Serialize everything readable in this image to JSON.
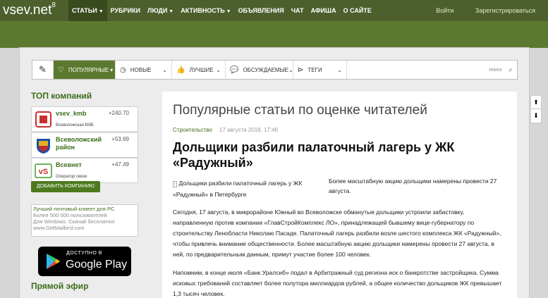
{
  "header": {
    "logo": "vsev.net",
    "logo_sup": "8",
    "nav": [
      {
        "label": "СТАТЬИ",
        "caret": true
      },
      {
        "label": "РУБРИКИ",
        "caret": false
      },
      {
        "label": "ЛЮДИ",
        "caret": true
      },
      {
        "label": "АКТИВНОСТЬ",
        "caret": true
      },
      {
        "label": "ОБЪЯВЛЕНИЯ",
        "caret": false
      },
      {
        "label": "ЧАТ",
        "caret": false
      },
      {
        "label": "АФИША",
        "caret": false
      },
      {
        "label": "О САЙТЕ",
        "caret": false
      }
    ],
    "login": "Войти",
    "register": "Зарегистрироваться"
  },
  "tabs": {
    "popular": "ПОПУЛЯРНЫЕ",
    "new": "НОВЫЕ",
    "best": "ЛУЧШИЕ",
    "discussed": "ОБСУЖДАЕМЫЕ",
    "tags": "ТЕГИ",
    "search": "поиск"
  },
  "sidebar": {
    "title": "ТОП компаний",
    "companies": [
      {
        "name": "vsev_kmb",
        "sub": "Всеволожская КМБ",
        "score": "+240.70"
      },
      {
        "name": "Всеволожский район",
        "sub": "",
        "score": "+53.69"
      },
      {
        "name": "Всевнет",
        "sub": "Оператор связи",
        "score": "+47.49"
      }
    ],
    "add_button": "ДОБАВИТЬ КОМПАНИЮ",
    "ad": {
      "line1": "Лучший почтовый клиент для PC",
      "line2": "Более 500 000 пользователей",
      "line3": "Для Windows. Скачай бесплатно!",
      "line4": "www.GetMailbird.com"
    },
    "gplay_small": "ДОСТУПНО В",
    "gplay_big": "Google Play",
    "live": "Прямой эфир"
  },
  "article": {
    "page_title": "Популярные статьи по оценке читателей",
    "category": "Строительство",
    "date": "17 августа 2018, 17:46",
    "title": "Дольщики разбили палаточный лагерь у ЖК «Радужный»",
    "image_alt": "Дольщики разбили палаточный лагерь у ЖК «Радужный» в Петербурге",
    "lead": "Более масштабную акцию дольщики намерены провести 27 августа.",
    "para1": "Сегодня, 17 августа, в микрорайоне Южный во Всеволожске обманутые дольщики устроили забастовку, направленную против компании «ГлавСтройКомплекс ЛО», принадлежащей бывшему вице-губернатору по строительству Ленобласти Николаю Пасаде. Палаточный лагерь разбили возле шестого комплекса ЖК «Радужный», чтобы привлечь внимание общественности. Более масштабную акцию дольщики намерены провести 27 августа, в ней, по предварительным данным, примут участие более 100 человек.",
    "para2": "Напомним, в конце июля «Банк Уралсиб» подал в Арбитражный суд региона иск о банкротстве застройщика. Сумма исковых требований составляет более полутора миллиардов рублей, а общее количество дольщиков ЖК превышает 1,3 тысяч человек."
  },
  "colors": {
    "topbar": "#4c5f2c",
    "accent": "#5c7a2f",
    "link_green": "#3c6d19"
  }
}
